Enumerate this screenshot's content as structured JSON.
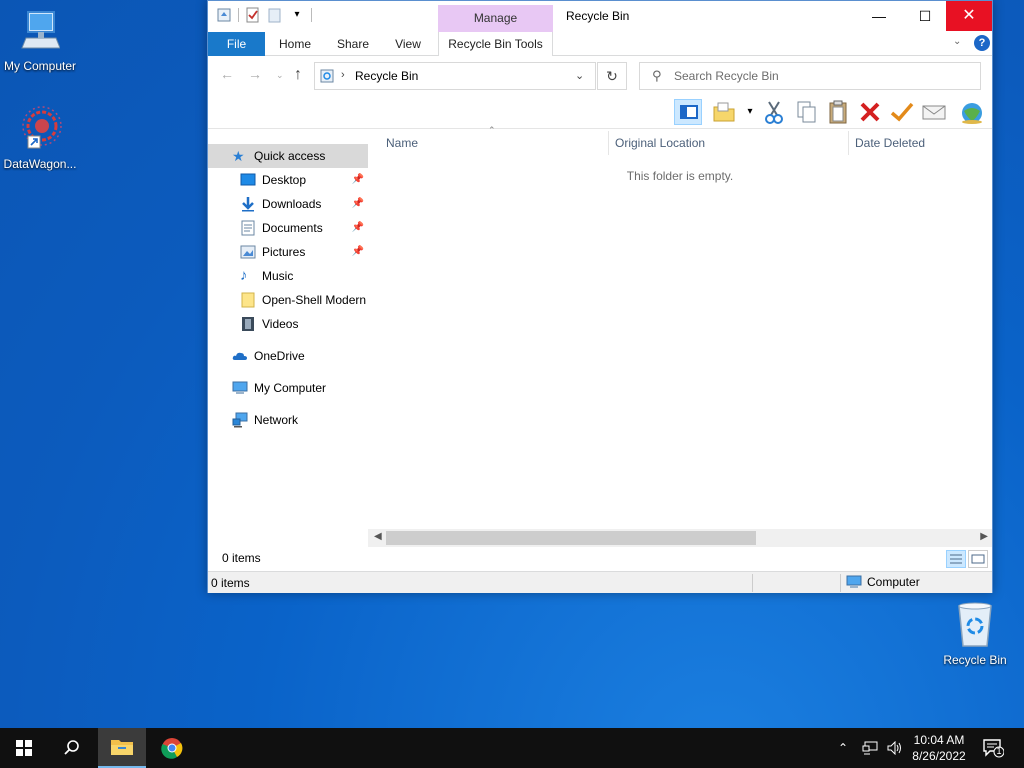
{
  "desktop": {
    "icons": [
      {
        "label": "My Computer"
      },
      {
        "label": "DataWagon..."
      },
      {
        "label": "Recycle Bin"
      }
    ]
  },
  "window": {
    "title": "Recycle Bin",
    "contextual_tab_group": "Manage",
    "tabs": {
      "file": "File",
      "home": "Home",
      "share": "Share",
      "view": "View",
      "recycle_bin_tools": "Recycle Bin Tools"
    },
    "help_label": "?",
    "address": {
      "path": "Recycle Bin"
    },
    "search": {
      "placeholder": "Search Recycle Bin"
    },
    "nav": {
      "quick_access": "Quick access",
      "items": [
        {
          "label": "Desktop"
        },
        {
          "label": "Downloads"
        },
        {
          "label": "Documents"
        },
        {
          "label": "Pictures"
        },
        {
          "label": "Music"
        },
        {
          "label": "Open-Shell Modern"
        },
        {
          "label": "Videos"
        }
      ],
      "onedrive": "OneDrive",
      "my_computer": "My Computer",
      "network": "Network"
    },
    "columns": {
      "name": "Name",
      "original_location": "Original Location",
      "date_deleted": "Date Deleted"
    },
    "empty_message": "This folder is empty.",
    "status_items": "0 items",
    "statusbar": {
      "items": "0 items",
      "location": "Computer"
    }
  },
  "taskbar": {
    "time": "10:04 AM",
    "date": "8/26/2022",
    "notification_count": "1"
  }
}
